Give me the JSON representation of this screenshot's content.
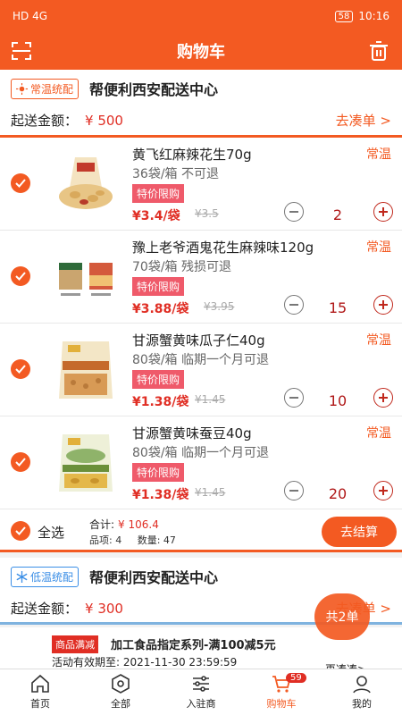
{
  "status": {
    "left": "HD 4G",
    "time": "10:16",
    "battery": "58"
  },
  "header": {
    "title": "购物车"
  },
  "stores": [
    {
      "tag": "常温统配",
      "name": "帮便利西安配送中心",
      "min_label": "起送金额：",
      "min_value": "¥ 500",
      "go": "去凑单 >"
    },
    {
      "tag": "低温统配",
      "name": "帮便利西安配送中心",
      "min_label": "起送金额：",
      "min_value": "¥ 300",
      "go": "去凑单 >"
    }
  ],
  "items": [
    {
      "name": "黄飞红麻辣花生70g",
      "spec": "36袋/箱  不可退",
      "promo": "特价限购",
      "price": "¥3.4/袋",
      "orig": "¥3.5",
      "storage": "常温",
      "qty": "2",
      "image": "peanut-bag-icon"
    },
    {
      "name": "豫上老爷酒鬼花生麻辣味120g",
      "spec": "70袋/箱  残损可退",
      "promo": "特价限购",
      "price": "¥3.88/袋",
      "orig": "¥3.95",
      "storage": "常温",
      "qty": "15",
      "image": "peanut-box-icon"
    },
    {
      "name": "甘源蟹黄味瓜子仁40g",
      "spec": "80袋/箱  临期一个月可退",
      "promo": "特价限购",
      "price": "¥1.38/袋",
      "orig": "¥1.45",
      "storage": "常温",
      "qty": "10",
      "image": "seed-bag-icon"
    },
    {
      "name": "甘源蟹黄味蚕豆40g",
      "spec": "80袋/箱  临期一个月可退",
      "promo": "特价限购",
      "price": "¥1.38/袋",
      "orig": "¥1.45",
      "storage": "常温",
      "qty": "20",
      "image": "bean-bag-icon"
    }
  ],
  "summary": {
    "select_all": "全选",
    "total_label": "合计:",
    "total_value": "¥ 106.4",
    "items_label": "品项: 4",
    "qty_label": "数量: 47",
    "checkout": "去结算"
  },
  "banner": {
    "tag": "商品满减",
    "text": "加工食品指定系列-满100减5元",
    "date": "活动有效期至:    2021-11-30 23:59:59",
    "more": "再凑凑>"
  },
  "float_button": "共2单",
  "tabs": [
    {
      "label": "首页",
      "icon": "home-icon"
    },
    {
      "label": "全部",
      "icon": "hexagon-icon"
    },
    {
      "label": "入驻商",
      "icon": "sliders-icon"
    },
    {
      "label": "购物车",
      "icon": "cart-icon",
      "badge": "59"
    },
    {
      "label": "我的",
      "icon": "user-icon"
    }
  ],
  "colors": {
    "accent": "#f35a22",
    "price": "#e02e24",
    "cold": "#3a8ee6"
  }
}
